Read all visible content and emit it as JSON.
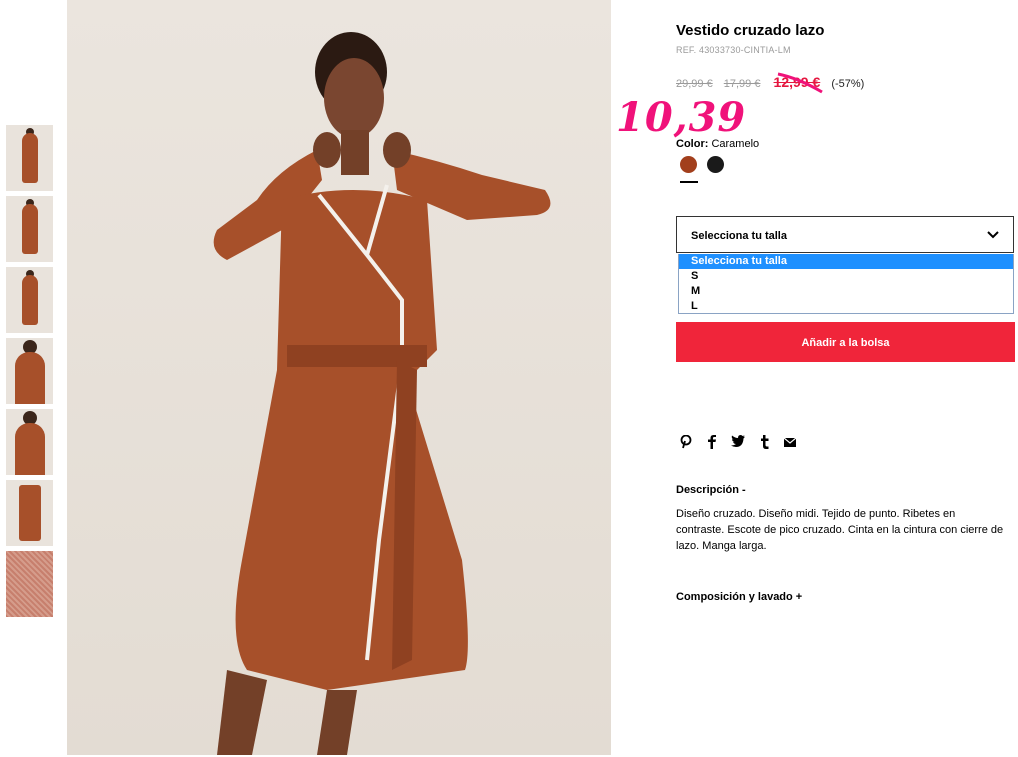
{
  "product": {
    "title": "Vestido cruzado lazo",
    "ref": "REF. 43033730-CINTIA-LM",
    "prices": {
      "original": "29,99 €",
      "previous": "17,99 €",
      "current": "12,99 €",
      "discount": "(-57%)",
      "handwritten": "10,39"
    },
    "color": {
      "label": "Color:",
      "value": "Caramelo",
      "swatches": [
        "#a23f1c",
        "#1a1a1a"
      ]
    },
    "size": {
      "placeholder": "Selecciona tu talla",
      "options": [
        "Selecciona tu talla",
        "S",
        "M",
        "L"
      ]
    },
    "add_to_bag": "Añadir a la bolsa",
    "social_icons": [
      "pinterest-icon",
      "facebook-icon",
      "twitter-icon",
      "tumblr-icon",
      "email-icon"
    ],
    "description": {
      "title": "Descripción -",
      "text": "Diseño cruzado. Diseño midi. Tejido de punto. Ribetes en contraste. Escote de pico cruzado. Cinta en la cintura con cierre de lazo. Manga larga."
    },
    "composition": {
      "title": "Composición y lavado +"
    }
  },
  "colors": {
    "accent": "#f0253a",
    "price_red": "#e5163f",
    "handwritten_pink": "#f0127a",
    "select_highlight": "#1e90ff"
  }
}
